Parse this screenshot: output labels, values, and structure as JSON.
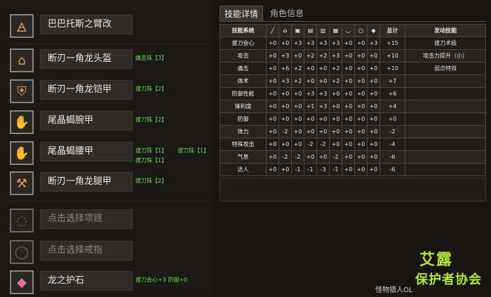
{
  "slots": [
    {
      "name": "巴巴托斯之臂改",
      "icon": "arm-armor-icon",
      "deco": []
    },
    {
      "name": "断刃一角龙头盔",
      "icon": "helmet-icon",
      "deco": [
        "痛击珠【3】"
      ]
    },
    {
      "name": "断刃一角龙铠甲",
      "icon": "chest-armor-icon",
      "deco": [
        "拔刀珠【2】"
      ]
    },
    {
      "name": "尾晶蝎腕甲",
      "icon": "gauntlet-icon",
      "deco": [
        "拔刀珠【2】"
      ]
    },
    {
      "name": "尾晶蝎腰甲",
      "icon": "waist-armor-icon",
      "deco": [
        "拔刀珠【1】",
        "拔刀珠【1】",
        "拔刀珠【1】"
      ]
    },
    {
      "name": "断刃一角龙腿甲",
      "icon": "leg-armor-icon",
      "deco": [
        "拔刀珠【2】"
      ]
    },
    {
      "name": "点击选择项链",
      "icon": "necklace-icon",
      "deco": []
    },
    {
      "name": "点击选择戒指",
      "icon": "ring-icon",
      "deco": []
    },
    {
      "name": "龙之护石",
      "icon": "charm-icon",
      "deco": [
        "拔刀会心+3 防御+0"
      ]
    }
  ],
  "tabs": {
    "active": "技能详情",
    "inactive": "角色信息"
  },
  "table": {
    "headers": [
      "技能系统",
      "总计",
      "发动技能"
    ],
    "column_icons": [
      "weapon-icon",
      "helmet-icon",
      "chest-icon",
      "arm-icon",
      "waist-icon",
      "leg-icon",
      "necklace-icon",
      "ring-icon",
      "charm-icon"
    ],
    "rows": [
      {
        "skill": "拔刀会心",
        "values": [
          "+0",
          "+0",
          "+3",
          "+3",
          "+3",
          "+3",
          "+0",
          "+0",
          "+3"
        ],
        "total": "+15",
        "active": "拔刀术极"
      },
      {
        "skill": "攻击",
        "values": [
          "+0",
          "+3",
          "+0",
          "+2",
          "+2",
          "+3",
          "+0",
          "+0",
          "+0"
        ],
        "total": "+10",
        "active": "攻击力提升（小）"
      },
      {
        "skill": "痛击",
        "values": [
          "+0",
          "+6",
          "+2",
          "+0",
          "+0",
          "+2",
          "+0",
          "+0",
          "+0"
        ],
        "total": "+10",
        "active": "弱点特效"
      },
      {
        "skill": "体术",
        "values": [
          "+0",
          "+3",
          "+2",
          "+0",
          "+0",
          "+2",
          "+0",
          "+0",
          "+0"
        ],
        "total": "+7",
        "active": ""
      },
      {
        "skill": "防御性能",
        "values": [
          "+0",
          "+0",
          "+0",
          "+3",
          "+3",
          "+0",
          "+0",
          "+0",
          "+0"
        ],
        "total": "+6",
        "active": ""
      },
      {
        "skill": "锋利度",
        "values": [
          "+0",
          "+0",
          "+0",
          "+1",
          "+3",
          "+0",
          "+0",
          "+0",
          "+0"
        ],
        "total": "+4",
        "active": ""
      },
      {
        "skill": "防御",
        "values": [
          "+0",
          "+0",
          "+0",
          "+0",
          "+0",
          "+0",
          "+0",
          "+0",
          "+0"
        ],
        "total": "+0",
        "active": ""
      },
      {
        "skill": "体力",
        "values": [
          "+0",
          "-2",
          "+0",
          "+0",
          "+0",
          "+0",
          "+0",
          "+0",
          "+0"
        ],
        "total": "-2",
        "active": ""
      },
      {
        "skill": "特殊攻击",
        "values": [
          "+0",
          "+0",
          "+0",
          "-2",
          "-2",
          "+0",
          "+0",
          "+0",
          "+0"
        ],
        "total": "-4",
        "active": ""
      },
      {
        "skill": "气息",
        "values": [
          "+0",
          "-2",
          "-2",
          "+0",
          "+0",
          "-2",
          "+0",
          "+0",
          "+0"
        ],
        "total": "-6",
        "active": ""
      },
      {
        "skill": "达人",
        "values": [
          "+0",
          "+0",
          "-1",
          "-1",
          "-3",
          "-1",
          "+0",
          "+0",
          "+0"
        ],
        "total": "-6",
        "active": ""
      }
    ]
  },
  "logo": {
    "line1": "艾露",
    "line2": "保护者协会",
    "bottom": "怪物猎人OL"
  }
}
